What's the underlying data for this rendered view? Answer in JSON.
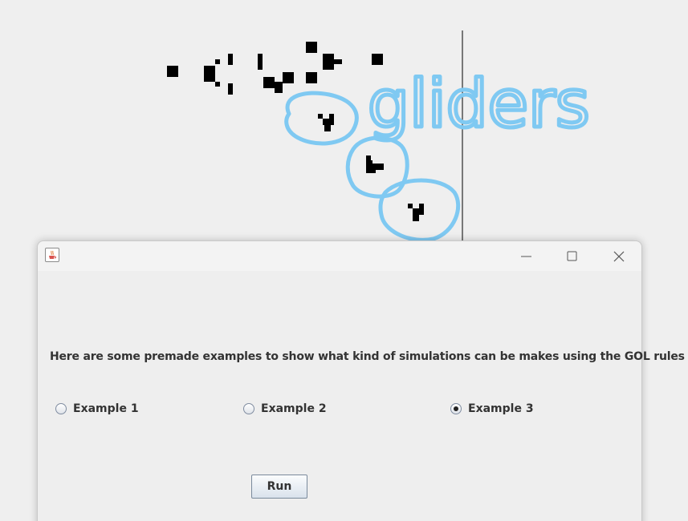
{
  "background": {
    "annotation": "gliders",
    "annotation_color": "#7fc9f2",
    "cell_color": "#000000"
  },
  "window": {
    "app_icon": "java-cup-icon",
    "controls": {
      "minimize": "minimize-icon",
      "maximize": "maximize-icon",
      "close": "close-icon"
    },
    "description": "Here are some premade examples to show what kind of simulations can be makes using the GOL rules",
    "options": [
      {
        "label": "Example 1",
        "selected": false
      },
      {
        "label": "Example 2",
        "selected": false
      },
      {
        "label": "Example 3",
        "selected": true
      }
    ],
    "run_label": "Run"
  }
}
